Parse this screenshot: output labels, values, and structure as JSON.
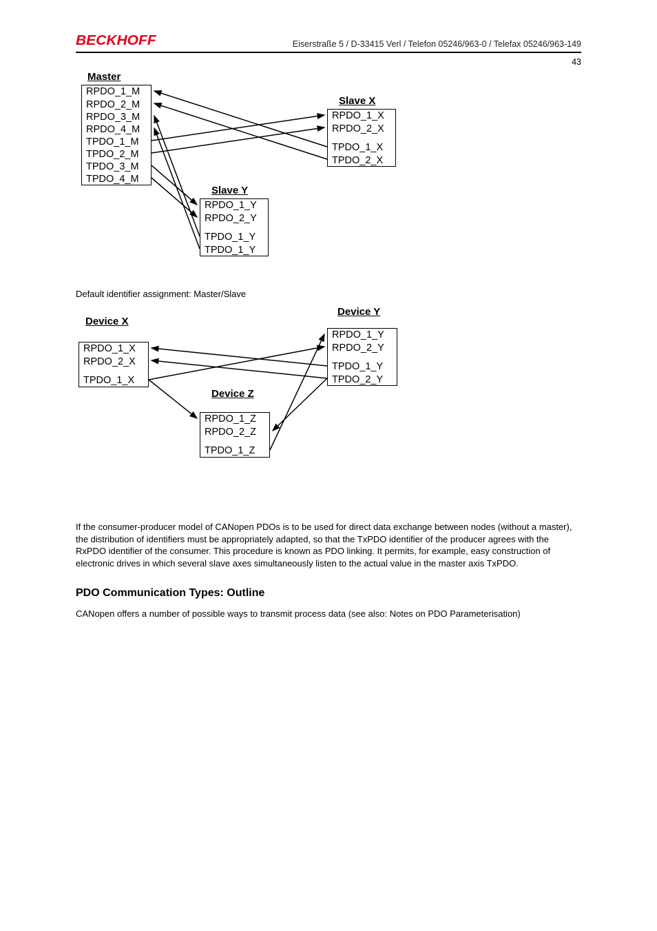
{
  "header": {
    "logo": "BECKHOFF",
    "info": "Eiserstraße 5 / D-33415 Verl / Telefon 05246/963-0 / Telefax 05246/963-149",
    "page_number": "43"
  },
  "diagram1": {
    "master": {
      "title": "Master",
      "rows": [
        "RPDO_1_M",
        "RPDO_2_M",
        "RPDO_3_M",
        "RPDO_4_M",
        "TPDO_1_M",
        "TPDO_2_M",
        "TPDO_3_M",
        "TPDO_4_M"
      ]
    },
    "slaveX": {
      "title": "Slave X",
      "rows": [
        "RPDO_1_X",
        "RPDO_2_X",
        "",
        "TPDO_1_X",
        "TPDO_2_X"
      ]
    },
    "slaveY": {
      "title": "Slave Y",
      "rows": [
        "RPDO_1_Y",
        "RPDO_2_Y",
        "",
        "TPDO_1_Y",
        "TPDO_1_Y"
      ]
    }
  },
  "caption1": "Default identifier assignment: Master/Slave",
  "diagram2": {
    "devX": {
      "title": "Device X",
      "rows": [
        "RPDO_1_X",
        "RPDO_2_X",
        "",
        "TPDO_1_X"
      ]
    },
    "devY": {
      "title": "Device Y",
      "rows": [
        "RPDO_1_Y",
        "RPDO_2_Y",
        "",
        "TPDO_1_Y",
        "TPDO_2_Y"
      ]
    },
    "devZ": {
      "title": "Device Z",
      "rows": [
        "RPDO_1_Z",
        "RPDO_2_Z",
        "",
        "TPDO_1_Z"
      ]
    }
  },
  "paragraph1": "If the consumer-producer model of CANopen PDOs is to be used for direct data exchange between nodes (without a master), the distribution of identifiers must be appropriately adapted, so that the TxPDO identifier of the producer agrees with the RxPDO identifier of the consumer. This procedure is known as PDO linking. It permits, for example, easy construction of electronic drives in which several slave axes simultaneously listen to the actual value in the master axis TxPDO.",
  "heading2": "PDO Communication Types: Outline",
  "paragraph2": "CANopen offers a number of possible ways to transmit process data (see also: Notes on PDO Parameterisation)"
}
